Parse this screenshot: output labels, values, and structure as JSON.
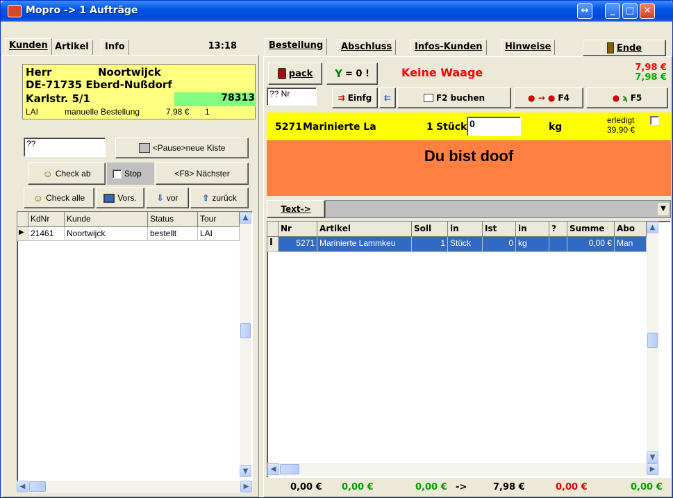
{
  "window": {
    "title": "Mopro -> 1 Aufträge",
    "restore_glyph": "↔",
    "minimize_glyph": "_",
    "maximize_glyph": "□",
    "close_glyph": "✕"
  },
  "left": {
    "tabs": [
      "Kunden",
      "Artikel",
      "Info"
    ],
    "time": "13:18",
    "customer": {
      "salutation": "Herr",
      "name": "Noortwijck",
      "city_line": "DE-71735 Eberd-Nußdorf",
      "street": "Karlstr. 5/1",
      "number": "78313",
      "tour": "LAI",
      "order_type": "manuelle Bestellung",
      "amount": "7,98 €",
      "count": "1"
    },
    "search_value": "??",
    "pause_button": "<Pause>neue Kiste",
    "check_ab_button": "Check ab",
    "stop_label": "Stop",
    "next_button": "<F8> Nächster",
    "check_alle_button": "Check alle",
    "vors_button": "Vors.",
    "vor_button": "vor",
    "zurueck_button": "zurück",
    "table": {
      "columns": [
        "KdNr",
        "Kunde",
        "Status",
        "Tour"
      ],
      "rows": [
        {
          "kdnr": "21461",
          "kunde": "Noortwijck",
          "status": "bestellt",
          "tour": "LAI"
        }
      ]
    }
  },
  "right": {
    "tabs": [
      "Bestellung",
      "Abschluss",
      "Infos-Kunden",
      "Hinweise"
    ],
    "ende_button": "Ende",
    "pack_button": "pack",
    "zero_button": "= 0 !",
    "scale_status": "Keine Waage",
    "price_top_red": "7,98 €",
    "price_top_green": "7,98 €",
    "nr_input": "?? Nr",
    "einfg_button": "Einfg",
    "buchen_button": "F2 buchen",
    "f4_button": "F4",
    "f5_button": "F5",
    "article_bar": {
      "code": "5271",
      "name": "Marinierte La",
      "quantity": "1",
      "unit": "Stück",
      "weight_input": "0",
      "weight_unit": "kg",
      "erledigt_label": "erledigt",
      "erledigt_price": "39,90 €"
    },
    "message": "Du bist doof",
    "text_button": "Text->",
    "table": {
      "columns": [
        "Nr",
        "Artikel",
        "Soll",
        "in",
        "Ist",
        "in",
        "?",
        "Summe",
        "Abo"
      ],
      "rows": [
        {
          "nr": "5271",
          "artikel": "Marinierte Lammkeu",
          "soll": "1",
          "in1": "Stück",
          "ist": "0",
          "in2": "kg",
          "q": "",
          "summe": "0,00 €",
          "abo": "Man"
        }
      ]
    },
    "footer": [
      {
        "value": "0,00 €",
        "color": "#000000"
      },
      {
        "value": "0,00 €",
        "color": "#00a000"
      },
      {
        "value": "0,00 €",
        "color": "#00a000"
      },
      {
        "value": "->",
        "color": "#000000"
      },
      {
        "value": "7,98 €",
        "color": "#000000"
      },
      {
        "value": "0,00 €",
        "color": "#e00000"
      },
      {
        "value": "0,00 €",
        "color": "#00a000"
      }
    ]
  },
  "colors": {
    "yellow": "#ffff80",
    "green_field": "#80ff80",
    "orange": "#ff8040",
    "red": "#ff0000",
    "green": "#00a000",
    "selection": "#316ac5"
  }
}
